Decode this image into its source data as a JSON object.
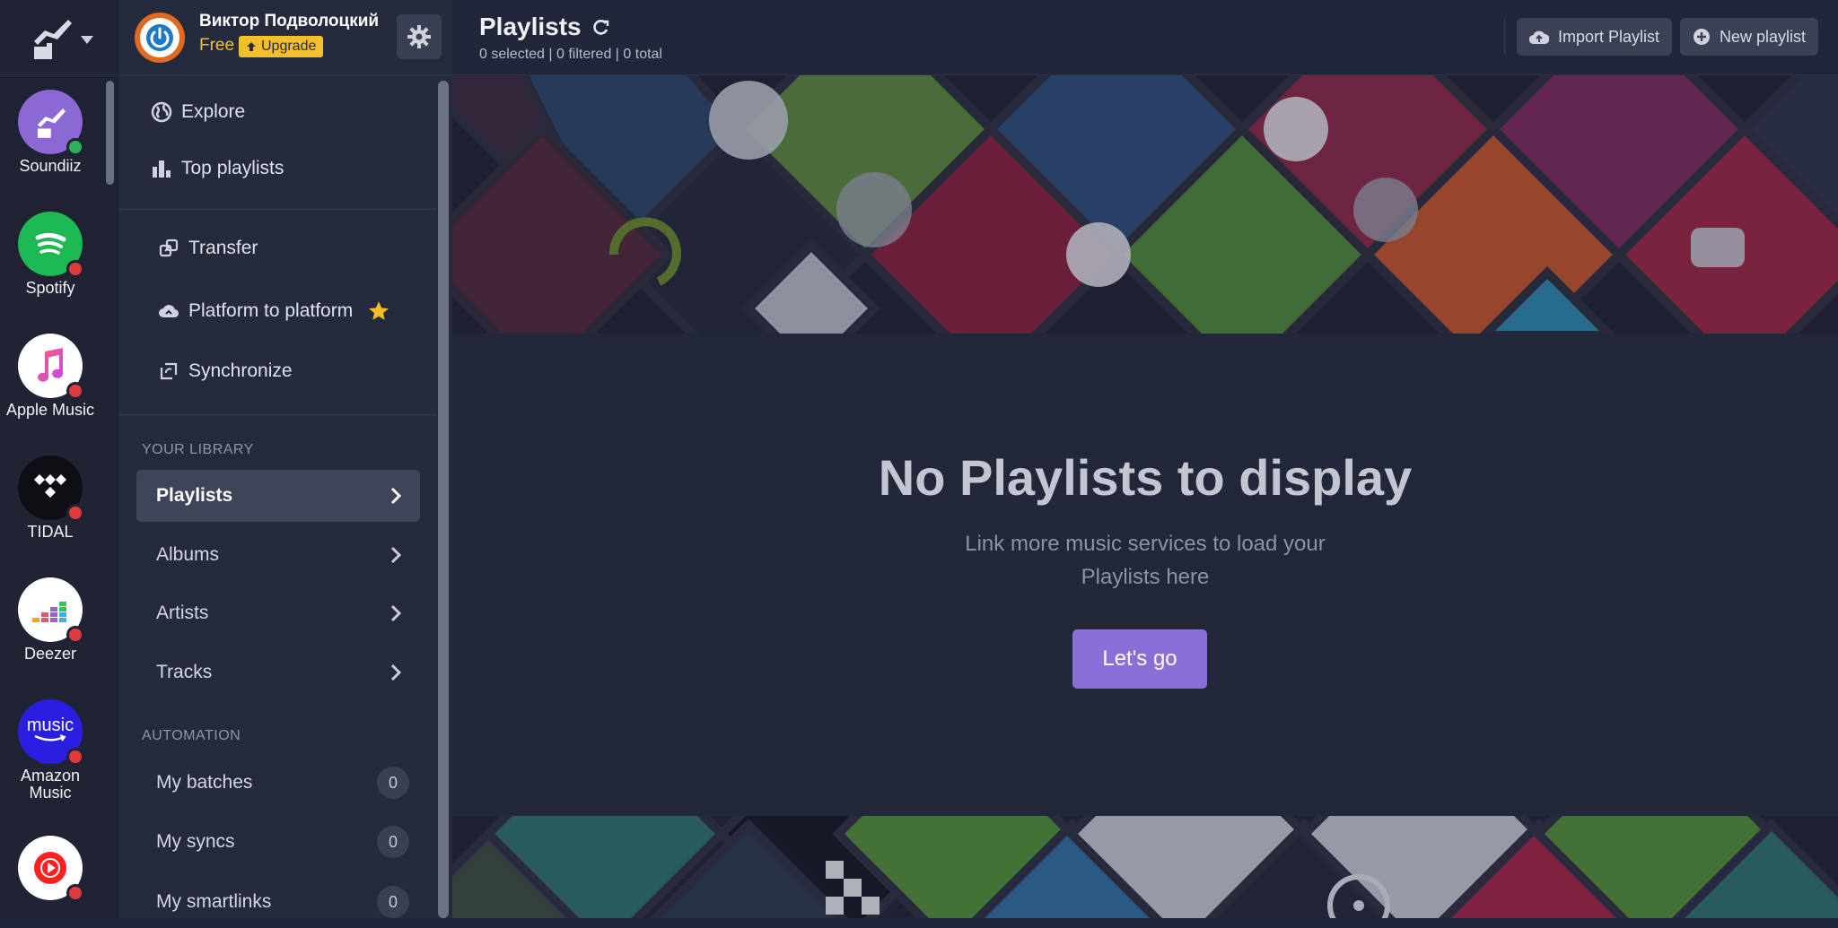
{
  "rail": {
    "services": [
      {
        "name": "Soundiiz",
        "bg": "#8b68d4",
        "status": "#2fae5d"
      },
      {
        "name": "Spotify",
        "bg": "#1db954",
        "status": "#e23a3a"
      },
      {
        "name": "Apple Music",
        "bg": "#ffffff",
        "status": "#e23a3a"
      },
      {
        "name": "TIDAL",
        "bg": "#0e0f14",
        "status": "#e23a3a"
      },
      {
        "name": "Deezer",
        "bg": "#ffffff",
        "status": "#e23a3a"
      },
      {
        "name": "Amazon Music",
        "bg": "#2a1fe0",
        "status": "#e23a3a",
        "logo_text": "music"
      },
      {
        "name": "",
        "bg": "#ffffff",
        "status": "#e23a3a"
      }
    ]
  },
  "profile": {
    "username": "Виктор Подволоцкий",
    "plan": "Free",
    "upgrade_label": "Upgrade"
  },
  "nav": {
    "explore": "Explore",
    "top_playlists": "Top playlists",
    "transfer": "Transfer",
    "platform_to_platform": "Platform to platform",
    "synchronize": "Synchronize",
    "library_heading": "YOUR LIBRARY",
    "library": [
      {
        "label": "Playlists"
      },
      {
        "label": "Albums"
      },
      {
        "label": "Artists"
      },
      {
        "label": "Tracks"
      }
    ],
    "automation_heading": "AUTOMATION",
    "automation": [
      {
        "label": "My batches",
        "count": "0"
      },
      {
        "label": "My syncs",
        "count": "0"
      },
      {
        "label": "My smartlinks",
        "count": "0"
      }
    ]
  },
  "header": {
    "title": "Playlists",
    "counts": "0 selected | 0 filtered | 0 total",
    "import_label": "Import Playlist",
    "new_label": "New playlist"
  },
  "empty_state": {
    "heading": "No Playlists to display",
    "text": "Link more music services to load your Playlists here",
    "button": "Let's go"
  },
  "colors": {
    "accent": "#8a6fd6",
    "upgrade": "#f3bf2b",
    "star": "#f4bf2a"
  }
}
